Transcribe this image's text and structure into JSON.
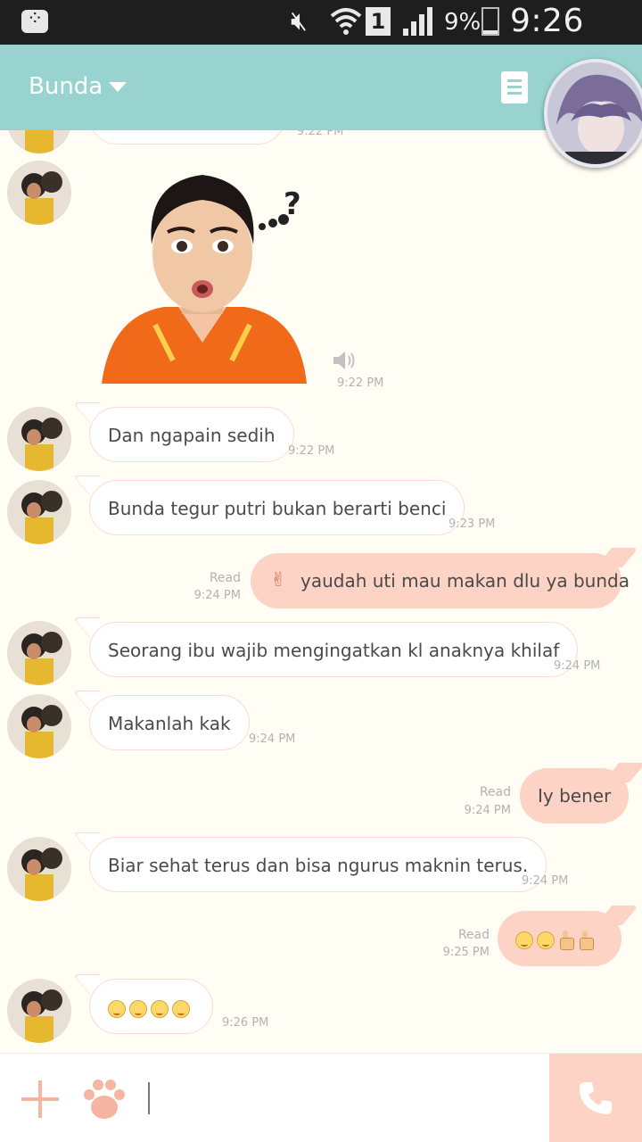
{
  "status_bar": {
    "battery_percent": "9%",
    "sim_slot": "1",
    "time": "9:26 PM"
  },
  "header": {
    "contact_name": "Bunda"
  },
  "messages": [
    {
      "time": "9:22 PM"
    },
    {
      "time": "9:22 PM"
    },
    {
      "text": "Dan ngapain sedih",
      "time": "9:22 PM"
    },
    {
      "text": "Bunda tegur putri bukan berarti benci",
      "time": "9:23 PM"
    },
    {
      "text": "yaudah uti mau makan dlu ya bunda",
      "status": "Read",
      "time": "9:24 PM"
    },
    {
      "text": "Seorang ibu wajib mengingatkan kl anaknya khilaf",
      "time": "9:24 PM"
    },
    {
      "text": "Makanlah kak",
      "time": "9:24 PM"
    },
    {
      "text": "Iy bener",
      "status": "Read",
      "time": "9:24 PM"
    },
    {
      "text": "Biar sehat terus dan bisa ngurus maknin terus.",
      "time": "9:24 PM"
    },
    {
      "status": "Read",
      "time": "9:25 PM"
    },
    {
      "time": "9:26 PM"
    }
  ],
  "colors": {
    "header": "#98d3cf",
    "outgoing_bubble": "#fcd3c4",
    "chat_background": "#fffdf4",
    "accent": "#f5b5a0"
  }
}
